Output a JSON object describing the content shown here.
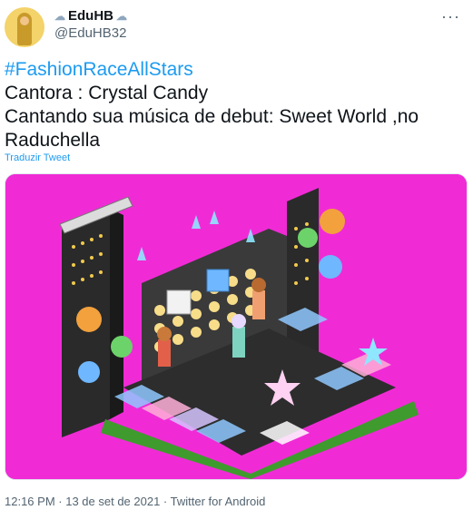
{
  "user": {
    "display_name": "EduHB",
    "handle": "@EduHB32",
    "name_icon_left": "cloud-lightning-icon",
    "name_icon_right": "cloud-lightning-icon"
  },
  "tweet": {
    "hashtag": "#FashionRaceAllStars",
    "lines": [
      "Cantora : Crystal Candy",
      "Cantando sua música de debut: Sweet World ,no",
      "Raduchella"
    ],
    "translate_label": "Traduzir Tweet"
  },
  "footer": {
    "time": "12:16 PM",
    "sep1": " · ",
    "date": "13 de set de 2021",
    "sep2": " · ",
    "client": "Twitter for Android"
  },
  "colors": {
    "link": "#1d9bf0",
    "muted": "#536471",
    "media_bg": "#f02bd6"
  }
}
